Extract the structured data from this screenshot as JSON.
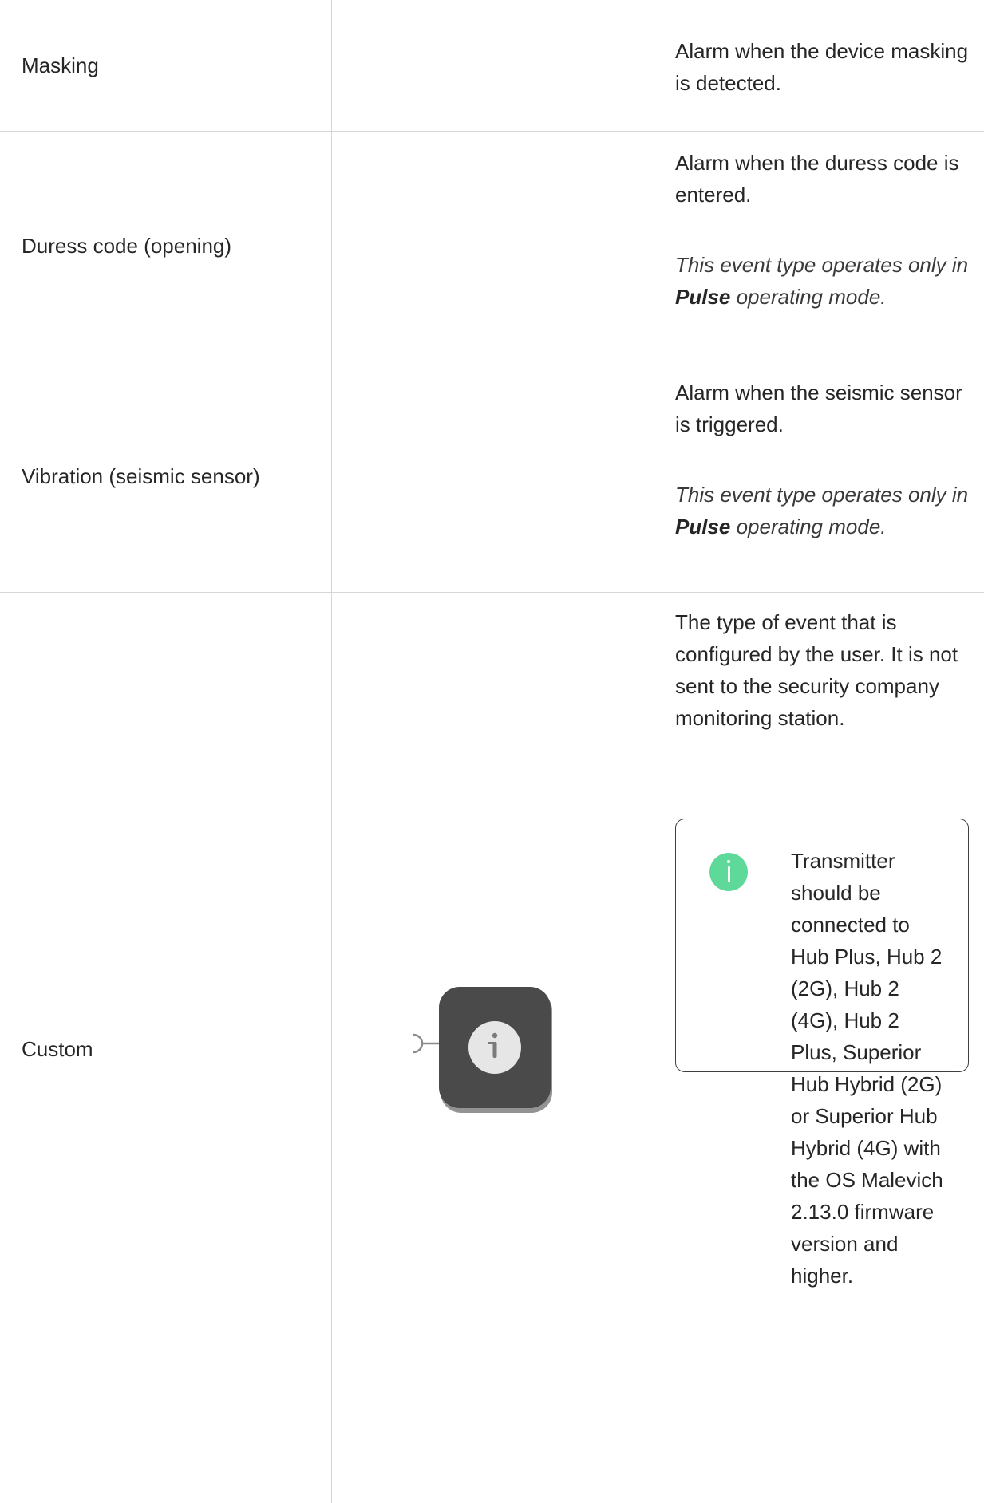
{
  "colors": {
    "grid_line": "#d6d6d6",
    "info_badge": "#5fd99a",
    "node_body": "#4a4a4a",
    "node_button": "#e6e6e6"
  },
  "rows": [
    {
      "event": "Masking",
      "description": "Alarm when the device masking is detected."
    },
    {
      "event": "Duress code (opening)",
      "description": "Alarm when the duress code is entered.",
      "note_prefix": "This event type operates only in ",
      "note_bold": "Pulse",
      "note_suffix": " operating mode."
    },
    {
      "event": "Vibration (seismic sensor)",
      "description": "Alarm when the seismic sensor is triggered.",
      "note_prefix": "This event type operates only in ",
      "note_bold": "Pulse",
      "note_suffix": " operating mode."
    },
    {
      "event": "Custom",
      "icon": "custom-event-node-icon",
      "description": "The type of event that is configured by the user. It is not sent to the security company monitoring station.",
      "info": {
        "icon": "info-icon",
        "text": "Transmitter should be connected to Hub Plus, Hub 2 (2G), Hub 2 (4G), Hub 2 Plus, Superior Hub Hybrid (2G) or Superior Hub Hybrid (4G) with the OS Malevich 2.13.0 firmware version and higher."
      }
    }
  ]
}
